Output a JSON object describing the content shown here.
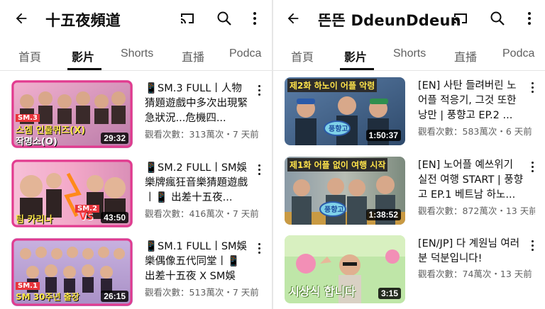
{
  "colors": {
    "text_primary": "#0f0f0f",
    "text_secondary": "#606060",
    "background": "#ffffff"
  },
  "left": {
    "header": {
      "title": "十五夜頻道",
      "back_icon": "back-arrow-icon",
      "cast_icon": "cast-icon",
      "search_icon": "search-icon",
      "more_icon": "more-vertical-icon"
    },
    "tabs": [
      {
        "label": "首頁",
        "active": false
      },
      {
        "label": "影片",
        "active": true
      },
      {
        "label": "Shorts",
        "active": false
      },
      {
        "label": "直播",
        "active": false
      },
      {
        "label": "Podca",
        "active": false
      }
    ],
    "videos": [
      {
        "title": "📱SM.3 FULL丨人物猜題遊戲中多次出現緊急狀況...危機四...",
        "meta": "觀看次數：313萬次・7 天前",
        "duration": "29:32",
        "thumb_text_1": "SM.3",
        "thumb_text_2": "스엠 인물퀴즈(X)",
        "thumb_text_3": "작명소(O)"
      },
      {
        "title": "📱SM.2 FULL丨SM娛樂牌瘋狂音樂猜題遊戲丨📱 出差十五夜...",
        "meta": "觀看次數：416萬次・7 天前",
        "duration": "43:50",
        "thumb_text_1": "SM.2",
        "thumb_text_2": "팀 카리나",
        "thumb_text_3": "VS"
      },
      {
        "title": "📱SM.1 FULL丨SM娛樂偶像五代同堂丨📱 出差十五夜 X SM娛樂...",
        "meta": "觀看次數：513萬次・7 天前",
        "duration": "26:15",
        "thumb_text_1": "SM.1",
        "thumb_text_2": "SM 30주년 출장",
        "thumb_text_3": ""
      }
    ]
  },
  "right": {
    "header": {
      "title": "뜬뜬 DdeunDdeun",
      "back_icon": "back-arrow-icon",
      "cast_icon": "cast-icon",
      "search_icon": "search-icon",
      "more_icon": "more-vertical-icon"
    },
    "tabs": [
      {
        "label": "首頁",
        "active": false
      },
      {
        "label": "影片",
        "active": true
      },
      {
        "label": "Shorts",
        "active": false
      },
      {
        "label": "直播",
        "active": false
      },
      {
        "label": "Podca",
        "active": false
      }
    ],
    "videos": [
      {
        "title": "[EN] 사탄 들려버린 노어플 적응기, 그것 또한 낭만 | 풍향고 EP.2 ...",
        "meta": "觀看次數：583萬次・6 天前",
        "duration": "1:50:37",
        "thumb_text_1": "제2화 하노이 어플 악령",
        "thumb_text_2": "풍향고",
        "thumb_text_3": ""
      },
      {
        "title": "[EN] 노어플 예쓰위기 실전 여행 START | 풍향고 EP.1 베트남 하노...",
        "meta": "觀看次數：872萬次・13 天前",
        "duration": "1:38:52",
        "thumb_text_1": "제1화 어플 없이 여행 시작",
        "thumb_text_2": "풍향고",
        "thumb_text_3": ""
      },
      {
        "title": "[EN/JP] 다 계원님 여러분 덕분입니다!",
        "meta": "觀看次數：74萬次・13 天前",
        "duration": "3:15",
        "thumb_text_1": "시상식 합니다",
        "thumb_text_2": "",
        "thumb_text_3": ""
      }
    ]
  }
}
